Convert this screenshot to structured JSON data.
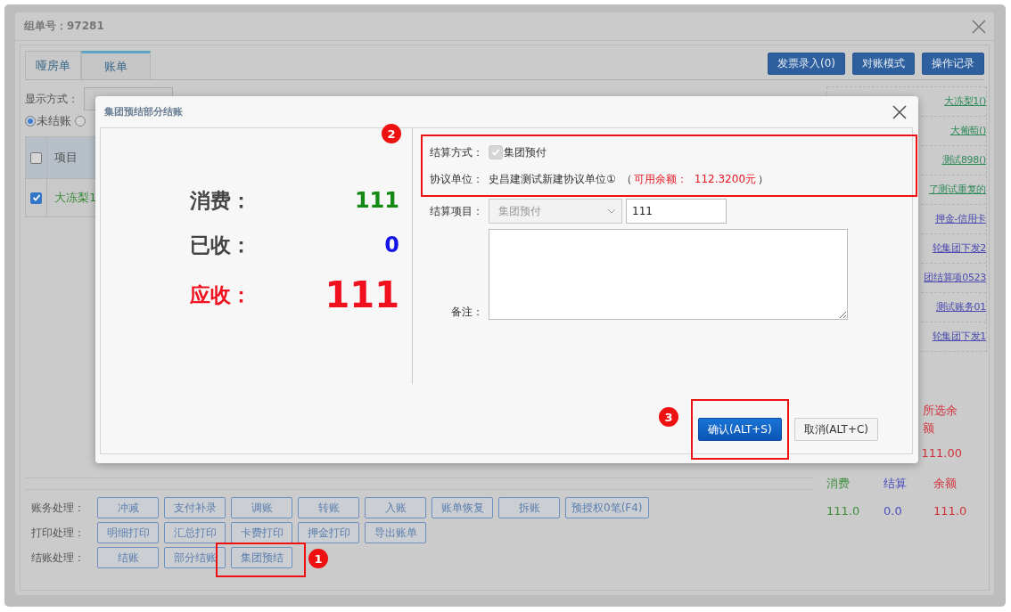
{
  "window": {
    "title_label": "组单号：",
    "title_value": "97281"
  },
  "tabs": [
    {
      "label": "哑房单",
      "selected": false
    },
    {
      "label": "账单",
      "selected": true
    }
  ],
  "toolbar_buttons": [
    "发票录入(0)",
    "对账模式",
    "操作记录"
  ],
  "display_mode": {
    "label": "显示方式："
  },
  "filter_radios": [
    {
      "label": "未结账",
      "selected": true
    },
    {
      "selected": false
    }
  ],
  "table": {
    "header_checked": false,
    "columns": [
      "项目"
    ],
    "rows": [
      {
        "item": "大冻梨1",
        "checked": true
      }
    ]
  },
  "side_links": [
    {
      "label": "大冻梨1()",
      "color": "#2f8a5a"
    },
    {
      "label": "大葡萄()",
      "color": "#2f8a5a"
    },
    {
      "label": "测试898()",
      "color": "#2f8a5a"
    },
    {
      "label": "了测试重复的",
      "color": "#2f8a5a"
    },
    {
      "label": "押金-信用卡",
      "color": "#4b4bb0"
    },
    {
      "label": "轮集团下发2",
      "color": "#4b4bb0"
    },
    {
      "label": "团结算项0523",
      "color": "#4b4bb0"
    },
    {
      "label": "测试账务01",
      "color": "#4b4bb0"
    },
    {
      "label": "轮集团下发1",
      "color": "#4b4bb0"
    }
  ],
  "summary": {
    "selected_balance_label": "所选余额",
    "selected_balance": "111.00",
    "columns": [
      {
        "label": "消费",
        "value": "111.0",
        "color": "#3f8f3f"
      },
      {
        "label": "结算",
        "value": "0.0",
        "color": "#4b4bc0"
      },
      {
        "label": "余额",
        "value": "111.0",
        "color": "#d0303a"
      }
    ]
  },
  "action_rows": [
    {
      "label": "账务处理：",
      "buttons": [
        "冲减",
        "支付补录",
        "调账",
        "转账",
        "入账",
        "账单恢复",
        "拆账",
        "预授权0笔(F4)"
      ]
    },
    {
      "label": "打印处理：",
      "buttons": [
        "明细打印",
        "汇总打印",
        "卡费打印",
        "押金打印",
        "导出账单"
      ]
    },
    {
      "label": "结账处理：",
      "buttons": [
        "结账",
        "部分结账",
        "集团预结"
      ],
      "step": "1"
    }
  ],
  "dialog": {
    "title": "集团预结部分结账",
    "stats": [
      {
        "kind": "normal",
        "label": "消费：",
        "value": "111",
        "color": "#138a13"
      },
      {
        "kind": "normal",
        "label": "已收：",
        "value": "0",
        "color": "#1414e6"
      },
      {
        "kind": "emphasis",
        "label": "应收：",
        "value": "111",
        "color": "#f0101e"
      }
    ],
    "settle_method": {
      "label": "结算方式：",
      "option": "集团预付",
      "checked": true,
      "disabled": true
    },
    "agreement": {
      "label": "协议单位：",
      "name": "史昌建测试新建协议单位①",
      "open_paren": "（",
      "balance_label": "可用余额：",
      "balance": "112.3200元",
      "close_paren": "）"
    },
    "settle_item": {
      "label": "结算项目：",
      "select_value": "集团预付",
      "amount": "111"
    },
    "remark": {
      "label": "备注："
    },
    "info_step": "2",
    "confirm_step": "3",
    "confirm_button": "确认(ALT+S)",
    "cancel_button": "取消(ALT+C)"
  }
}
